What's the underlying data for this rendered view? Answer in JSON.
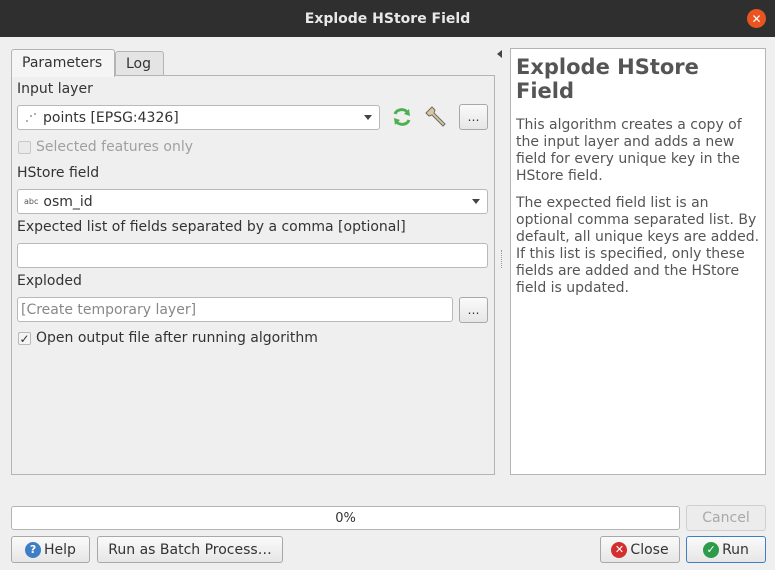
{
  "window": {
    "title": "Explode HStore Field"
  },
  "tabs": [
    {
      "label": "Parameters",
      "active": true
    },
    {
      "label": "Log",
      "active": false
    }
  ],
  "params": {
    "input_layer": {
      "label": "Input layer",
      "value": "points [EPSG:4326]",
      "icon": "point-layer-icon"
    },
    "selected_only": {
      "label": "Selected features only",
      "checked": false,
      "enabled": false
    },
    "hstore_field": {
      "label": "HStore field",
      "value": "osm_id",
      "type_badge": "abc"
    },
    "expected_fields": {
      "label": "Expected list of fields separated by a comma [optional]",
      "value": ""
    },
    "exploded": {
      "label": "Exploded",
      "placeholder": "[Create temporary layer]"
    },
    "open_output": {
      "label": "Open output file after running algorithm",
      "checked": true
    },
    "ellipsis": "…"
  },
  "help": {
    "title": "Explode HStore Field",
    "paragraphs": [
      "This algorithm creates a copy of the input layer and adds a new field for every unique key in the HStore field.",
      "The expected field list is an optional comma separated list. By default, all unique keys are added. If this list is specified, only these fields are added and the HStore field is updated."
    ]
  },
  "progress": {
    "value": 0,
    "text": "0%"
  },
  "buttons": {
    "cancel": "Cancel",
    "help": "Help",
    "batch": "Run as Batch Process…",
    "close": "Close",
    "run": "Run"
  },
  "colors": {
    "titlebar": "#2f2f2f",
    "close_accent": "#e95420",
    "run_border": "#3d7fc4",
    "refresh_green": "#4caf50"
  }
}
